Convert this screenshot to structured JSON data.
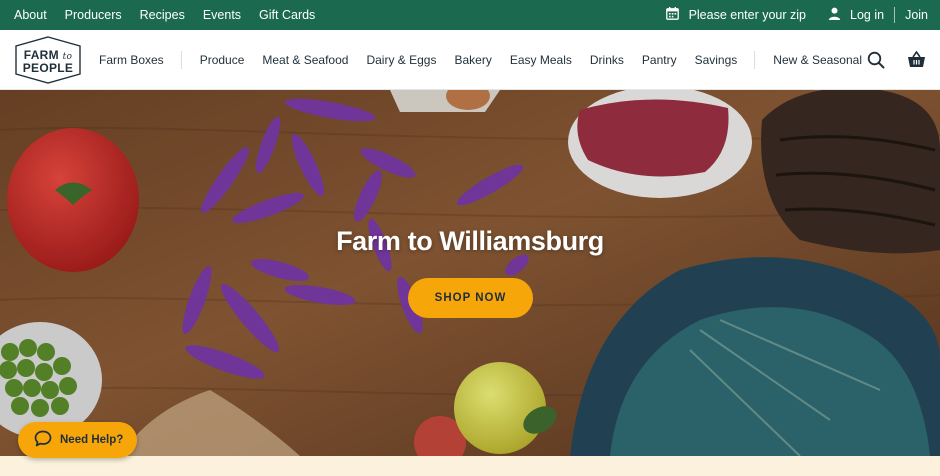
{
  "topbar": {
    "links": [
      "About",
      "Producers",
      "Recipes",
      "Events",
      "Gift Cards"
    ],
    "zip_prompt": "Please enter your zip",
    "login_label": "Log in",
    "join_label": "Join",
    "background": "#1b6a4f"
  },
  "logo": {
    "line1": "FARM",
    "connector": "to",
    "line2": "PEOPLE"
  },
  "nav": {
    "items": [
      "Farm Boxes",
      "Produce",
      "Meat & Seafood",
      "Dairy & Eggs",
      "Bakery",
      "Easy Meals",
      "Drinks",
      "Pantry",
      "Savings",
      "New & Seasonal"
    ],
    "icons": [
      "search-icon",
      "basket-icon"
    ]
  },
  "hero": {
    "title": "Farm to Williamsburg",
    "cta_label": "SHOP NOW",
    "cta_color": "#f7a60a"
  },
  "help": {
    "label": "Need Help?",
    "icon": "chat-bubble-icon"
  },
  "icons": {
    "zip": "calendar-icon",
    "login": "user-icon"
  }
}
